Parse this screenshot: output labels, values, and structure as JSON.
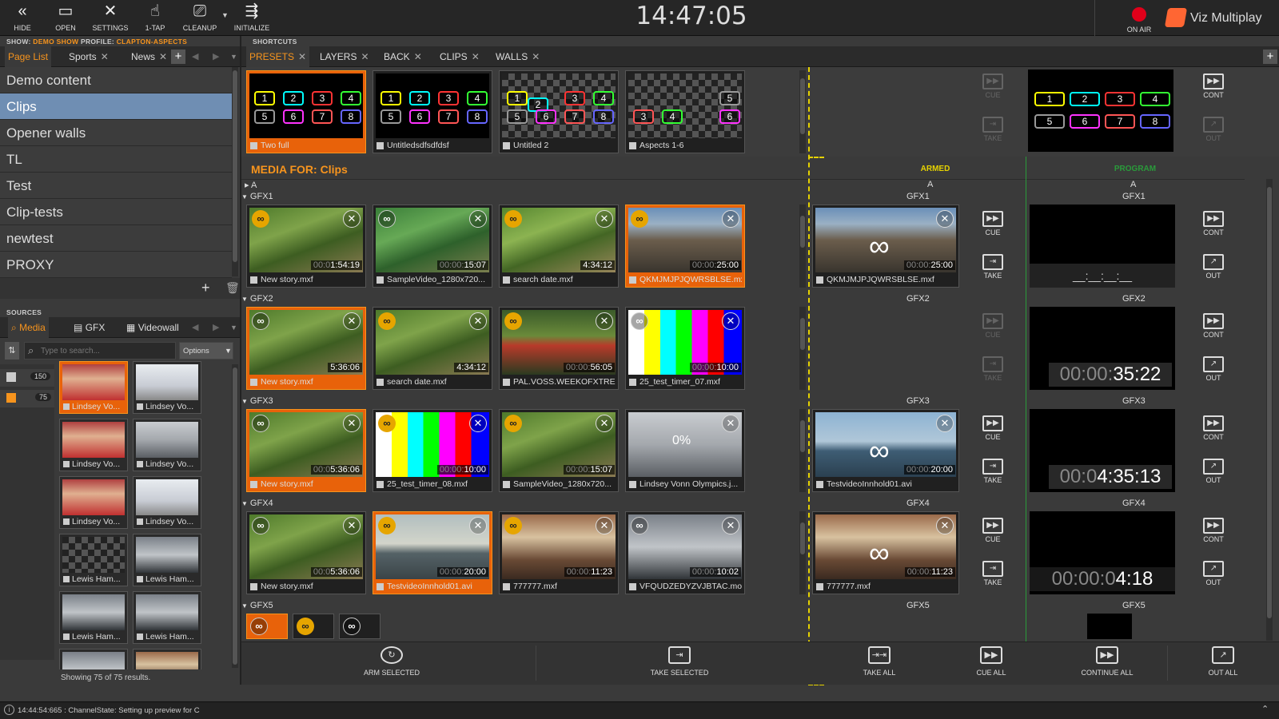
{
  "topbar": {
    "buttons": [
      "HIDE",
      "OPEN",
      "SETTINGS",
      "1-TAP",
      "CLEANUP",
      "INITIALIZE"
    ],
    "clock": "14:47:05",
    "on_air": "ON AIR",
    "brand": "Viz Multiplay"
  },
  "show_info": {
    "show_label": "SHOW:",
    "show": "DEMO SHOW",
    "profile_label": "PROFILE:",
    "profile": "CLAPTON-ASPECTS"
  },
  "pagelist": {
    "tabs": [
      "Page List",
      "Sports",
      "News"
    ],
    "items": [
      "Demo content",
      "Clips",
      "Opener walls",
      "TL",
      "Test",
      "Clip-tests",
      "newtest",
      "PROXY"
    ],
    "selected": "Clips"
  },
  "sources": {
    "title": "SOURCES",
    "tabs": [
      "Media",
      "GFX",
      "Videowall"
    ],
    "search_placeholder": "Type to search...",
    "options": "Options",
    "counts": [
      "150",
      "75"
    ],
    "items": [
      "Lindsey Vo...",
      "Lindsey Vo...",
      "Lindsey Vo...",
      "Lindsey Vo...",
      "Lindsey Vo...",
      "Lindsey Vo...",
      "Lewis Ham...",
      "Lewis Ham...",
      "Lewis Ham...",
      "Lewis Ham..."
    ],
    "results": "Showing 75 of 75 results."
  },
  "shortcuts": {
    "title": "SHORTCUTS",
    "tabs": [
      "PRESETS",
      "LAYERS",
      "BACK",
      "CLIPS",
      "WALLS"
    ],
    "presets": [
      "Two full",
      "Untitledsdfsdfdsf",
      "Untitled 2",
      "Aspects 1-6"
    ],
    "slots": [
      "1",
      "2",
      "3",
      "4",
      "5",
      "6",
      "7",
      "8"
    ]
  },
  "media": {
    "label": "MEDIA FOR:",
    "page": "Clips",
    "armed": "ARMED",
    "program": "PROGRAM",
    "channel_a": "A",
    "groups": [
      {
        "name": "GFX1",
        "clips": [
          {
            "name": "New story.mxf",
            "dur_dim": "00:0",
            "dur": "1:54:19"
          },
          {
            "name": "SampleVideo_1280x720...",
            "dur_dim": "00:00:",
            "dur": "15:07"
          },
          {
            "name": "search date.mxf",
            "dur_dim": "",
            "dur": "4:34:12"
          },
          {
            "name": "QKMJMJPJQWRSBLSE.mxf",
            "dur_dim": "00:00:",
            "dur": "25:00"
          }
        ],
        "armed": {
          "name": "QKMJMJPJQWRSBLSE.mxf",
          "dur_dim": "00:00:",
          "dur": "25:00"
        },
        "program": {
          "dur_text": "__:__:__:__"
        }
      },
      {
        "name": "GFX2",
        "clips": [
          {
            "name": "New story.mxf",
            "dur_dim": "",
            "dur": "5:36:06"
          },
          {
            "name": "search date.mxf",
            "dur_dim": "",
            "dur": "4:34:12"
          },
          {
            "name": "PAL.VOSS.WEEKOFXTRE...",
            "dur_dim": "00:00:",
            "dur": "56:05"
          },
          {
            "name": "25_test_timer_07.mxf",
            "dur_dim": "00:00:",
            "dur": "10:00"
          }
        ],
        "program": {
          "dur_dim": "00:00:",
          "dur": "35:22"
        }
      },
      {
        "name": "GFX3",
        "clips": [
          {
            "name": "New story.mxf",
            "dur_dim": "00:0",
            "dur": "5:36:06"
          },
          {
            "name": "25_test_timer_08.mxf",
            "dur_dim": "00:00:",
            "dur": "10:00"
          },
          {
            "name": "SampleVideo_1280x720...",
            "dur_dim": "00:00:",
            "dur": "15:07"
          },
          {
            "name": "Lindsey Vonn Olympics.j...",
            "dur_dim": "",
            "dur": "",
            "progress": "0%"
          }
        ],
        "armed": {
          "name": "TestvideoInnhold01.avi",
          "dur_dim": "00:00:",
          "dur": "20:00"
        },
        "program": {
          "dur_dim": "00:0",
          "dur": "4:35:13"
        }
      },
      {
        "name": "GFX4",
        "clips": [
          {
            "name": "New story.mxf",
            "dur_dim": "00:0",
            "dur": "5:36:06"
          },
          {
            "name": "TestvideoInnhold01.avi",
            "dur_dim": "00:00:",
            "dur": "20:00"
          },
          {
            "name": "777777.mxf",
            "dur_dim": "00:00:",
            "dur": "11:23"
          },
          {
            "name": "VFQUDZEDYZVJBTAC.mov",
            "dur_dim": "00:00:",
            "dur": "10:02"
          }
        ],
        "armed": {
          "name": "777777.mxf",
          "dur_dim": "00:00:",
          "dur": "11:23"
        },
        "program": {
          "dur_dim": "00:00:0",
          "dur": "4:18"
        }
      },
      {
        "name": "GFX5"
      }
    ],
    "controls": {
      "cue": "CUE",
      "take": "TAKE",
      "cont": "CONT",
      "out": "OUT"
    }
  },
  "bottom": [
    "ARM SELECTED",
    "TAKE SELECTED",
    "TAKE ALL",
    "CUE ALL",
    "CONTINUE ALL",
    "OUT ALL"
  ],
  "status": "14:44:54:665 : ChannelState: Setting up preview for C",
  "colors": {
    "accent": "#f7941d",
    "selected": "#6f8eb3",
    "armed_line": "#e6d200",
    "program_line": "#2a9a3a",
    "onair": "#e0001a"
  }
}
